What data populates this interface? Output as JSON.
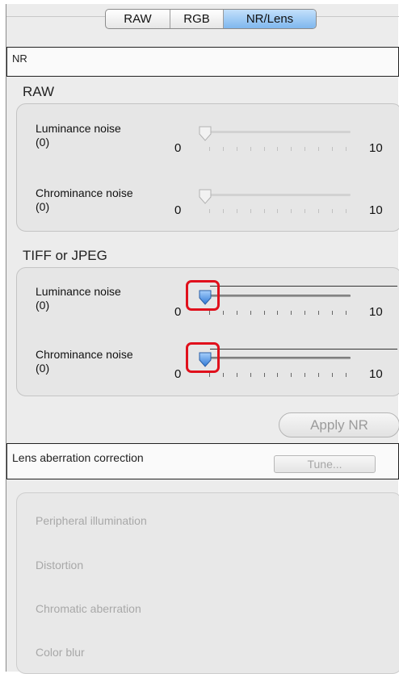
{
  "tabs": [
    "RAW",
    "RGB",
    "NR/Lens"
  ],
  "nr_header": "NR",
  "raw": {
    "title": "RAW",
    "luminance": {
      "label": "Luminance noise",
      "value": "(0)",
      "min": "0",
      "max": "10",
      "level": 0
    },
    "chrominance": {
      "label": "Chrominance noise",
      "value": "(0)",
      "min": "0",
      "max": "10",
      "level": 0
    }
  },
  "tiff": {
    "title": "TIFF or JPEG",
    "luminance": {
      "label": "Luminance noise",
      "value": "(0)",
      "min": "0",
      "max": "10",
      "level": 0
    },
    "chrominance": {
      "label": "Chrominance noise",
      "value": "(0)",
      "min": "0",
      "max": "10",
      "level": 0
    }
  },
  "apply_label": "Apply NR",
  "lens": {
    "header": "Lens aberration correction",
    "tune_label": "Tune...",
    "items": [
      "Peripheral illumination",
      "Distortion",
      "Chromatic aberration",
      "Color blur"
    ]
  },
  "colors": {
    "active_tab": "#8cc0f0",
    "highlight": "#e0101c",
    "knob_active": "#4a8fe0"
  },
  "icons": {
    "slider_knob": "slider-knob-icon"
  }
}
